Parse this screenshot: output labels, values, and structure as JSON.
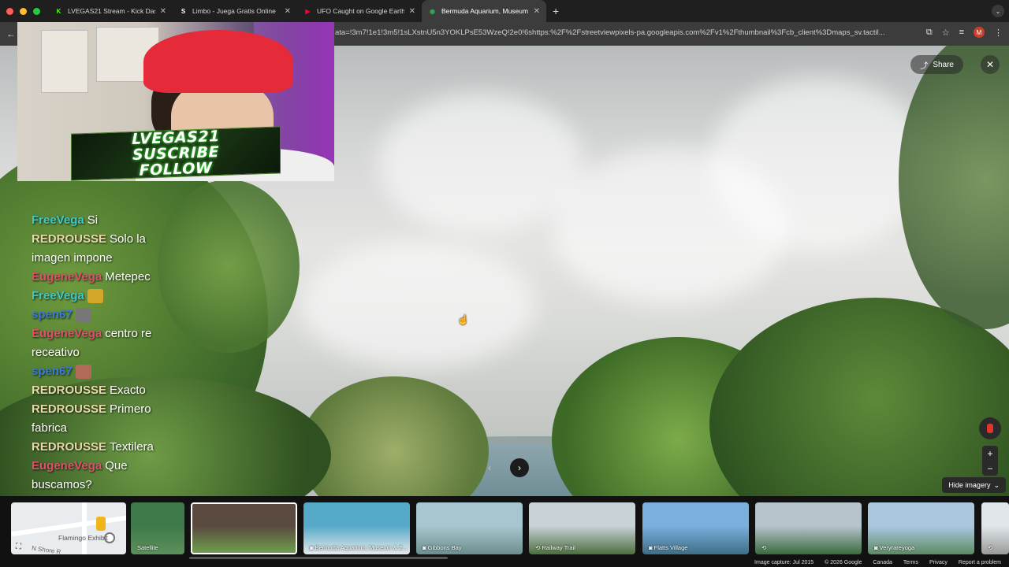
{
  "browser": {
    "tabs": [
      {
        "label": "LVEGAS21 Stream - Kick Das",
        "favicon": "K",
        "favicon_color": "#53fc18"
      },
      {
        "label": "Limbo - Juega Gratis Online",
        "favicon": "S",
        "favicon_color": "#ffffff"
      },
      {
        "label": "UFO Caught on Google Earth",
        "favicon": "▶",
        "favicon_color": "#ff0033"
      },
      {
        "label": "Bermuda Aquarium, Museum",
        "favicon": "◉",
        "favicon_color": "#34a853",
        "active": true
      }
    ],
    "url": "ata=!3m7!1e1!3m5!1sLXstnU5n3YOKLPsE53WzeQ!2e0!6shttps:%2F%2Fstreetviewpixels-pa.googleapis.com%2Fv1%2Fthumbnail%3Fcb_client%3Dmaps_sv.tactil...",
    "profile_initial": "M",
    "profile_color": "#c5412b"
  },
  "streetview": {
    "share_label": "Share",
    "hide_imagery_label": "Hide imagery",
    "zoom_in": "+",
    "zoom_out": "−"
  },
  "webcam": {
    "banner_line1": "LVEGAS21",
    "banner_line2": "SUSCRIBE",
    "banner_line3": "FOLLOW"
  },
  "chat": [
    {
      "user": "FreeVega",
      "text": "Si",
      "color": "#3ec9c9"
    },
    {
      "user": "REDROUSSE",
      "text": "Solo la imagen impone",
      "color": "#e7d8a6"
    },
    {
      "user": "EugeneVega",
      "text": "Metepec",
      "color": "#e0506a"
    },
    {
      "user": "FreeVega",
      "text": "",
      "color": "#3ec9c9",
      "emote": "#d4a62a"
    },
    {
      "user": "spen67",
      "text": "",
      "color": "#3a7bd5",
      "emote": "#777777"
    },
    {
      "user": "EugeneVega",
      "text": "centro re receativo",
      "color": "#e0506a"
    },
    {
      "user": "spen67",
      "text": "",
      "color": "#3a7bd5",
      "emote": "#b36a5a"
    },
    {
      "user": "REDROUSSE",
      "text": "Exacto",
      "color": "#e7d8a6"
    },
    {
      "user": "REDROUSSE",
      "text": "Primero fabrica",
      "color": "#e7d8a6"
    },
    {
      "user": "REDROUSSE",
      "text": "Textilera",
      "color": "#e7d8a6"
    },
    {
      "user": "EugeneVega",
      "text": "Que buscamos?",
      "color": "#e0506a"
    }
  ],
  "filmstrip": {
    "map_poi": "Flamingo Exhibit",
    "map_street": "N Shore R",
    "thumbs": [
      {
        "label": "Satellite",
        "icon": "",
        "colors": [
          "#3f7a4a",
          "#5d8f5a"
        ]
      },
      {
        "label": "",
        "icon": "",
        "colors": [
          "#5a4a3f",
          "#6e9e4e"
        ],
        "selected": true
      },
      {
        "label": "Bermuda Aquarium, Museum & Z...",
        "icon": "camera",
        "colors": [
          "#55a9c9",
          "#e6e9ea"
        ]
      },
      {
        "label": "Gibbons Bay",
        "icon": "camera",
        "colors": [
          "#a8c6d0",
          "#6b8e8e"
        ]
      },
      {
        "label": "Railway Trail",
        "icon": "360",
        "colors": [
          "#c8d3d8",
          "#4c6e3e"
        ]
      },
      {
        "label": "Flatts Village",
        "icon": "camera",
        "colors": [
          "#7bb0de",
          "#3e6e86"
        ]
      },
      {
        "label": "",
        "icon": "360",
        "colors": [
          "#b7c4cc",
          "#3a6a3e"
        ]
      },
      {
        "label": "Veryrareyoga",
        "icon": "camera",
        "colors": [
          "#a9c8e0",
          "#5d8a63"
        ]
      },
      {
        "label": "",
        "icon": "360",
        "colors": [
          "#e0e6ea",
          "#9a9a9a"
        ]
      }
    ]
  },
  "footer": {
    "capture": "Image capture: Jul 2015",
    "copyright": "© 2026 Google",
    "country": "Canada",
    "terms": "Terms",
    "privacy": "Privacy",
    "report": "Report a problem"
  }
}
